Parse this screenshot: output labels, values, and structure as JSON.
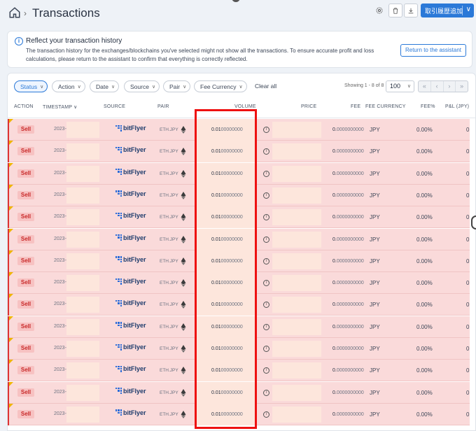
{
  "header": {
    "title": "Transactions",
    "breadcrumb_sep": "›",
    "primary_button": "取引履歴追加",
    "primary_chevron": "∨"
  },
  "banner": {
    "title": "Reflect your transaction history",
    "text": "The transaction history for the exchanges/blockchains you've selected might not show all the transactions. To ensure accurate profit and loss calculations, please return to the assistant to confirm that everything is correctly reflected.",
    "button": "Return to the assistant"
  },
  "filters": {
    "chips": [
      "Status",
      "Action",
      "Date",
      "Source",
      "Pair",
      "Fee Currency"
    ],
    "clear_all": "Clear all",
    "showing": "Showing 1 - 8 of 8",
    "page_size": "100",
    "pager": [
      "«",
      "‹",
      "›",
      "»"
    ]
  },
  "columns": {
    "action": "ACTION",
    "timestamp": "TIMESTAMP",
    "source": "SOURCE",
    "pair": "PAIR",
    "volume": "VOLUME",
    "price": "PRICE",
    "fee": "FEE",
    "fee_currency": "FEE CURRENCY",
    "fee_pct": "FEE%",
    "pnl": "P&L (JPY)"
  },
  "rows": [
    {
      "action": "Sell",
      "timestamp": "2023-",
      "source": "bitFlyer",
      "pair": "ETH.JPY",
      "volume_main": "0.01",
      "volume_rest": "00000000",
      "fee_main": "0.",
      "fee_rest": "0000000000",
      "fee_currency": "JPY",
      "fee_pct": "0.00%",
      "pnl": "0"
    },
    {
      "action": "Sell",
      "timestamp": "2023-",
      "source": "bitFlyer",
      "pair": "ETH.JPY",
      "volume_main": "0.01",
      "volume_rest": "00000000",
      "fee_main": "0.",
      "fee_rest": "0000000000",
      "fee_currency": "JPY",
      "fee_pct": "0.00%",
      "pnl": "0"
    },
    {
      "action": "Sell",
      "timestamp": "2023-",
      "source": "bitFlyer",
      "pair": "ETH.JPY",
      "volume_main": "0.01",
      "volume_rest": "00000000",
      "fee_main": "0.",
      "fee_rest": "0000000000",
      "fee_currency": "JPY",
      "fee_pct": "0.00%",
      "pnl": "0"
    },
    {
      "action": "Sell",
      "timestamp": "2023-",
      "source": "bitFlyer",
      "pair": "ETH.JPY",
      "volume_main": "0.01",
      "volume_rest": "00000000",
      "fee_main": "0.",
      "fee_rest": "0000000000",
      "fee_currency": "JPY",
      "fee_pct": "0.00%",
      "pnl": "0"
    },
    {
      "action": "Sell",
      "timestamp": "2023-",
      "source": "bitFlyer",
      "pair": "ETH.JPY",
      "volume_main": "0.01",
      "volume_rest": "00000000",
      "fee_main": "0.",
      "fee_rest": "0000000000",
      "fee_currency": "JPY",
      "fee_pct": "0.00%",
      "pnl": "0"
    },
    {
      "action": "Sell",
      "timestamp": "2023-",
      "source": "bitFlyer",
      "pair": "ETH.JPY",
      "volume_main": "0.01",
      "volume_rest": "00000000",
      "fee_main": "0.",
      "fee_rest": "0000000000",
      "fee_currency": "JPY",
      "fee_pct": "0.00%",
      "pnl": "0"
    },
    {
      "action": "Sell",
      "timestamp": "2023-",
      "source": "bitFlyer",
      "pair": "ETH.JPY",
      "volume_main": "0.01",
      "volume_rest": "00000000",
      "fee_main": "0.",
      "fee_rest": "0000000000",
      "fee_currency": "JPY",
      "fee_pct": "0.00%",
      "pnl": "0"
    },
    {
      "action": "Sell",
      "timestamp": "2023-",
      "source": "bitFlyer",
      "pair": "ETH.JPY",
      "volume_main": "0.01",
      "volume_rest": "00000000",
      "fee_main": "0.",
      "fee_rest": "0000000000",
      "fee_currency": "JPY",
      "fee_pct": "0.00%",
      "pnl": "0"
    },
    {
      "action": "Sell",
      "timestamp": "2023-",
      "source": "bitFlyer",
      "pair": "ETH.JPY",
      "volume_main": "0.01",
      "volume_rest": "00000000",
      "fee_main": "0.",
      "fee_rest": "0000000000",
      "fee_currency": "JPY",
      "fee_pct": "0.00%",
      "pnl": "0"
    },
    {
      "action": "Sell",
      "timestamp": "2023-",
      "source": "bitFlyer",
      "pair": "ETH.JPY",
      "volume_main": "0.01",
      "volume_rest": "00000000",
      "fee_main": "0.",
      "fee_rest": "0000000000",
      "fee_currency": "JPY",
      "fee_pct": "0.00%",
      "pnl": "0"
    },
    {
      "action": "Sell",
      "timestamp": "2023-",
      "source": "bitFlyer",
      "pair": "ETH.JPY",
      "volume_main": "0.01",
      "volume_rest": "00000000",
      "fee_main": "0.",
      "fee_rest": "0000000000",
      "fee_currency": "JPY",
      "fee_pct": "0.00%",
      "pnl": "0"
    },
    {
      "action": "Sell",
      "timestamp": "2023-",
      "source": "bitFlyer",
      "pair": "ETH.JPY",
      "volume_main": "0.01",
      "volume_rest": "00000000",
      "fee_main": "0.",
      "fee_rest": "0000000000",
      "fee_currency": "JPY",
      "fee_pct": "0.00%",
      "pnl": "0"
    },
    {
      "action": "Sell",
      "timestamp": "2023-",
      "source": "bitFlyer",
      "pair": "ETH.JPY",
      "volume_main": "0.01",
      "volume_rest": "00000000",
      "fee_main": "0.",
      "fee_rest": "0000000000",
      "fee_currency": "JPY",
      "fee_pct": "0.00%",
      "pnl": "0"
    },
    {
      "action": "Sell",
      "timestamp": "2023-",
      "source": "bitFlyer",
      "pair": "ETH.JPY",
      "volume_main": "0.01",
      "volume_rest": "00000000",
      "fee_main": "0.",
      "fee_rest": "0000000000",
      "fee_currency": "JPY",
      "fee_pct": "0.00%",
      "pnl": "0"
    }
  ],
  "colors": {
    "accent": "#2b79d8",
    "sell_row_bg": "#fadada",
    "sell_badge_text": "#c92a2a",
    "highlight": "#e11111"
  },
  "icons": {
    "home": "home-icon",
    "settings": "gear-icon",
    "delete": "trash-icon",
    "download": "download-icon",
    "info": "info-icon",
    "ethereum": "ethereum-icon"
  }
}
